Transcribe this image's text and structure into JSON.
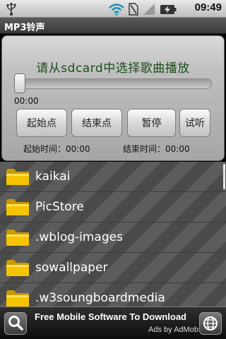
{
  "status": {
    "time": "09:49",
    "icons": [
      "usb-icon",
      "wifi-icon",
      "no-sim-icon",
      "signal-icon",
      "battery-charging-icon"
    ]
  },
  "app": {
    "title": "MP3铃声"
  },
  "player": {
    "instruction": "请从sdcard中选择歌曲播放",
    "seek_time": "00:00",
    "seek_progress": 0,
    "buttons": {
      "start": "起始点",
      "end": "结束点",
      "pause": "暂停",
      "listen": "试听"
    },
    "start_time_label": "起始时间：00:00",
    "end_time_label": "结束时间：00:00"
  },
  "files": [
    {
      "name": "kaikai"
    },
    {
      "name": "PicStore"
    },
    {
      "name": ".wblog-images"
    },
    {
      "name": "sowallpaper"
    },
    {
      "name": ".w3soungboardmedia"
    }
  ],
  "ad": {
    "title": "Free Mobile Software To Download",
    "subtitle": "Ads by AdMob"
  },
  "colors": {
    "instruction_text": "#1d4d1d",
    "title_bar": "#4a4a4a",
    "folder_yellow": "#f4c400"
  }
}
